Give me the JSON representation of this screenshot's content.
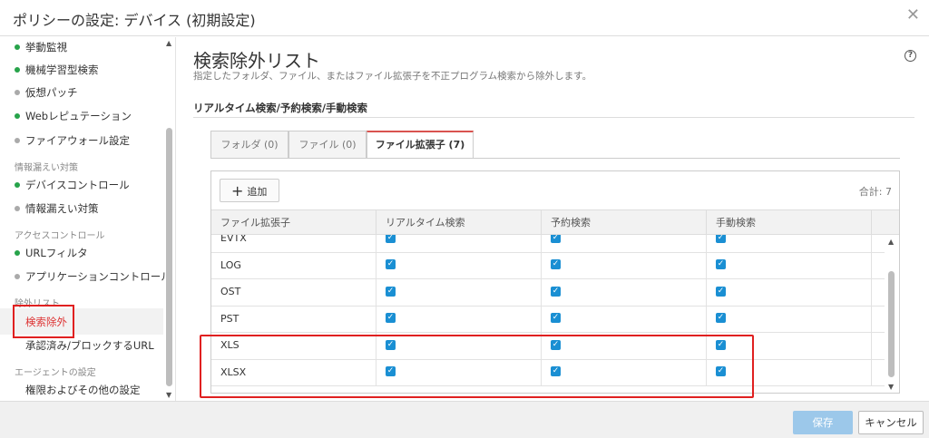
{
  "window": {
    "title": "ポリシーの設定: デバイス (初期設定)",
    "close_glyph": "✕"
  },
  "sidebar": {
    "items": [
      {
        "label": "挙動監視",
        "status": "green"
      },
      {
        "label": "機械学習型検索",
        "status": "green"
      },
      {
        "label": "仮想パッチ",
        "status": "gray"
      },
      {
        "label": "Webレピュテーション",
        "status": "green"
      },
      {
        "label": "ファイアウォール設定",
        "status": "gray"
      }
    ],
    "group_info_leak": "情報漏えい対策",
    "items2": [
      {
        "label": "デバイスコントロール",
        "status": "green"
      },
      {
        "label": "情報漏えい対策",
        "status": "gray"
      }
    ],
    "group_access": "アクセスコントロール",
    "items3": [
      {
        "label": "URLフィルタ",
        "status": "green"
      },
      {
        "label": "アプリケーションコントロール",
        "status": "gray"
      }
    ],
    "group_exclusion": "除外リスト",
    "exclusion_items": [
      "検索除外",
      "承認済み/ブロックするURL"
    ],
    "group_agent": "エージェントの設定",
    "agent_items": [
      "権限およびその他の設定"
    ]
  },
  "main": {
    "title": "検索除外リスト",
    "description": "指定したフォルダ、ファイル、またはファイル拡張子を不正プログラム検索から除外します。",
    "section": "リアルタイム検索/予約検索/手動検索",
    "tabs": [
      "フォルダ (0)",
      "ファイル (0)",
      "ファイル拡張子 (7)"
    ],
    "add_label": "追加",
    "total_label": "合計: 7",
    "columns": [
      "ファイル拡張子",
      "リアルタイム検索",
      "予約検索",
      "手動検索"
    ],
    "rows": [
      "EVTX",
      "LOG",
      "OST",
      "PST",
      "XLS",
      "XLSX"
    ]
  },
  "footer": {
    "save": "保存",
    "cancel": "キャンセル"
  },
  "colors": {
    "accent": "#1a8fd3",
    "status_on": "#27a34a",
    "highlight": "#e02020"
  }
}
